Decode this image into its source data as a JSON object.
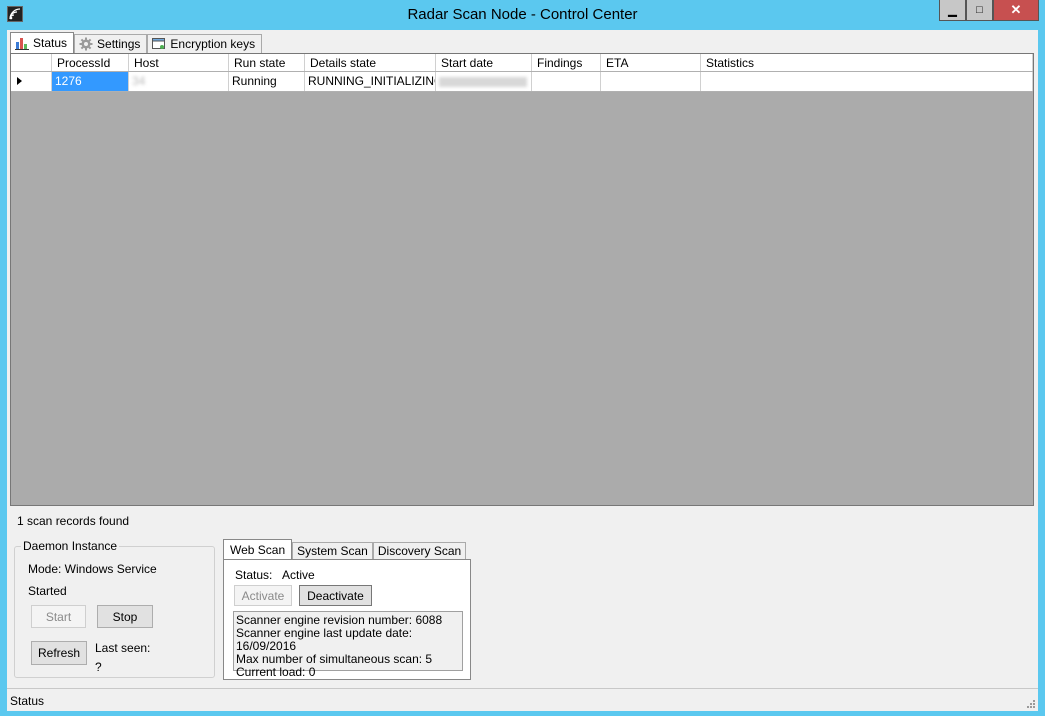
{
  "window": {
    "title": "Radar Scan Node - Control Center"
  },
  "title_buttons": {
    "minimize": "▁",
    "maximize": "□",
    "close": "✕"
  },
  "tabs": [
    {
      "label": "Status",
      "icon": "bar-chart-icon"
    },
    {
      "label": "Settings",
      "icon": "gear-icon"
    },
    {
      "label": "Encryption keys",
      "icon": "key-window-icon"
    }
  ],
  "grid": {
    "columns": [
      "ProcessId",
      "Host",
      "Run state",
      "Details state",
      "Start date",
      "Findings",
      "ETA",
      "Statistics"
    ],
    "rows": [
      {
        "process_id": "1276",
        "host": "34",
        "run_state": "Running",
        "details_state": "RUNNING_INITIALIZING",
        "start_date": "",
        "findings": "",
        "eta": "",
        "statistics": ""
      }
    ]
  },
  "records_count": "1 scan records found",
  "daemon": {
    "legend": "Daemon Instance",
    "mode": "Mode: Windows Service",
    "state": "Started",
    "start_label": "Start",
    "stop_label": "Stop",
    "refresh_label": "Refresh",
    "last_seen_label": "Last seen:",
    "last_seen_value": "?"
  },
  "scan_tabs": [
    "Web Scan",
    "System Scan",
    "Discovery Scan"
  ],
  "web_scan": {
    "status_label": "Status:",
    "status_value": "Active",
    "activate_label": "Activate",
    "deactivate_label": "Deactivate",
    "info": [
      "Scanner engine revision number: 6088",
      "Scanner engine last update date: 16/09/2016",
      "Max number of simultaneous scan: 5",
      "Current load: 0"
    ]
  },
  "statusbar": {
    "text": "Status"
  }
}
